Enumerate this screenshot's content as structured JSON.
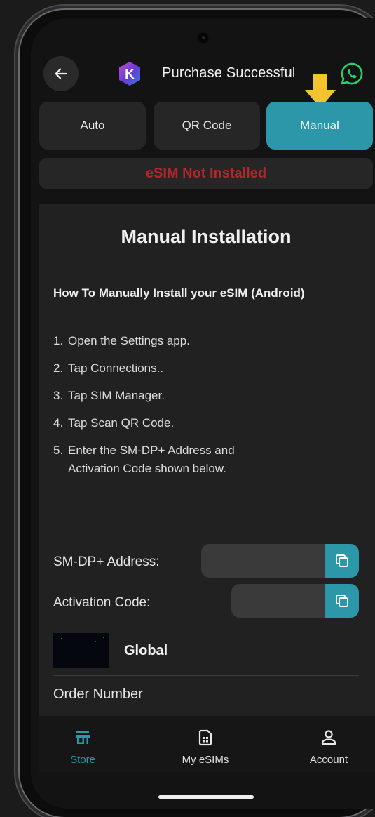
{
  "header": {
    "title": "Purchase Successful",
    "logo_letter": "K"
  },
  "tabs": [
    {
      "label": "Auto",
      "active": false
    },
    {
      "label": "QR Code",
      "active": false
    },
    {
      "label": "Manual",
      "active": true
    }
  ],
  "status": {
    "text": "eSIM Not Installed",
    "color": "#b3262a"
  },
  "manual": {
    "title": "Manual Installation",
    "subtitle": "How To Manually Install your eSIM (Android)",
    "steps": [
      {
        "num": "1.",
        "text": "Open the Settings app."
      },
      {
        "num": "2.",
        "text": "Tap Connections.."
      },
      {
        "num": "3.",
        "text": "Tap SIM Manager."
      },
      {
        "num": "4.",
        "text": "Tap Scan QR Code."
      },
      {
        "num": "5.",
        "text": "Enter the SM-DP+ Address and",
        "cont": "Activation Code shown below."
      }
    ],
    "smdp_label": "SM-DP+ Address:",
    "activation_label": "Activation Code:"
  },
  "plan": {
    "name": "Global",
    "order_label": "Order Number"
  },
  "nav": [
    {
      "label": "Store",
      "icon": "store-icon",
      "active": true
    },
    {
      "label": "My eSIMs",
      "icon": "sim-card-icon",
      "active": false
    },
    {
      "label": "Account",
      "icon": "account-icon",
      "active": false
    }
  ],
  "colors": {
    "accent": "#2b97a8",
    "background": "#131313",
    "card": "#212121",
    "hint_arrow": "#f4c430",
    "whatsapp": "#25d366"
  }
}
